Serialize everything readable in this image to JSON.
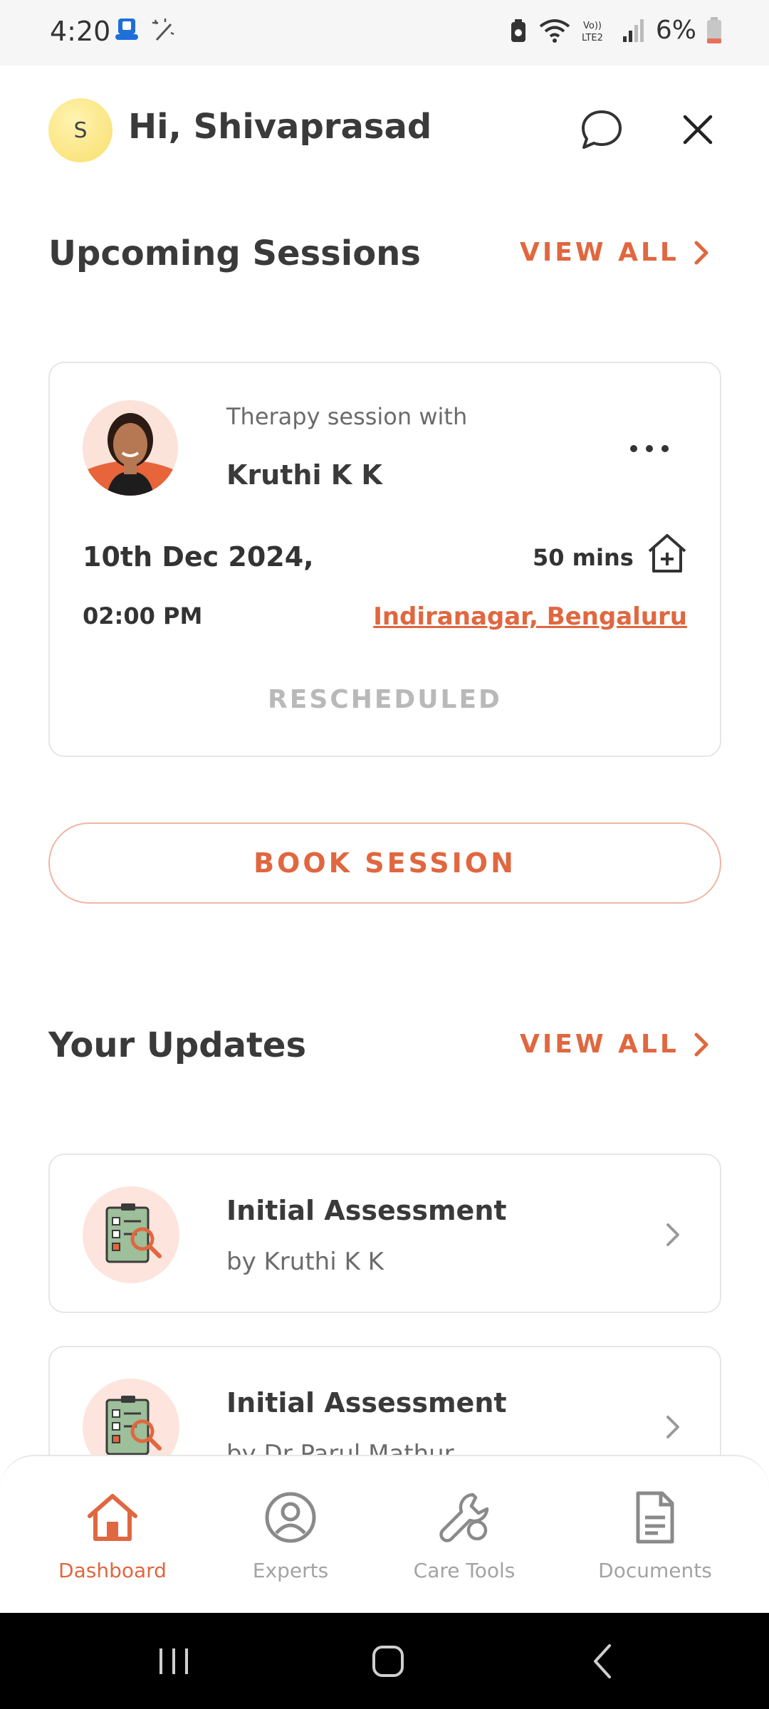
{
  "status_bar": {
    "time": "4:20",
    "battery": "6%",
    "icons": [
      "app-notification-icon",
      "magic-wand-icon",
      "battery-saver-icon",
      "wifi-icon",
      "volte-icon",
      "signal-icon",
      "battery-icon"
    ]
  },
  "header": {
    "avatar_initial": "S",
    "greeting": "Hi, Shivaprasad"
  },
  "upcoming": {
    "title": "Upcoming Sessions",
    "view_all": "VIEW ALL",
    "session": {
      "with_label": "Therapy session with",
      "therapist": "Kruthi K K",
      "date": "10th Dec 2024,",
      "time": "02:00 PM",
      "duration": "50 mins",
      "location": "Indiranagar, Bengaluru",
      "status": "RESCHEDULED"
    }
  },
  "book_button": "BOOK SESSION",
  "updates": {
    "title": "Your Updates",
    "view_all": "VIEW ALL",
    "items": [
      {
        "title": "Initial Assessment",
        "author": "by Kruthi K K"
      },
      {
        "title": "Initial Assessment",
        "author": "by Dr Parul Mathur"
      }
    ]
  },
  "nav": {
    "items": [
      {
        "label": "Dashboard",
        "icon": "home-icon",
        "active": true
      },
      {
        "label": "Experts",
        "icon": "person-icon",
        "active": false
      },
      {
        "label": "Care Tools",
        "icon": "wrench-icon",
        "active": false
      },
      {
        "label": "Documents",
        "icon": "document-icon",
        "active": false
      }
    ]
  },
  "colors": {
    "accent": "#e0673f",
    "avatar_bg": "#f8df6c",
    "muted_text": "#a3a3a3"
  }
}
